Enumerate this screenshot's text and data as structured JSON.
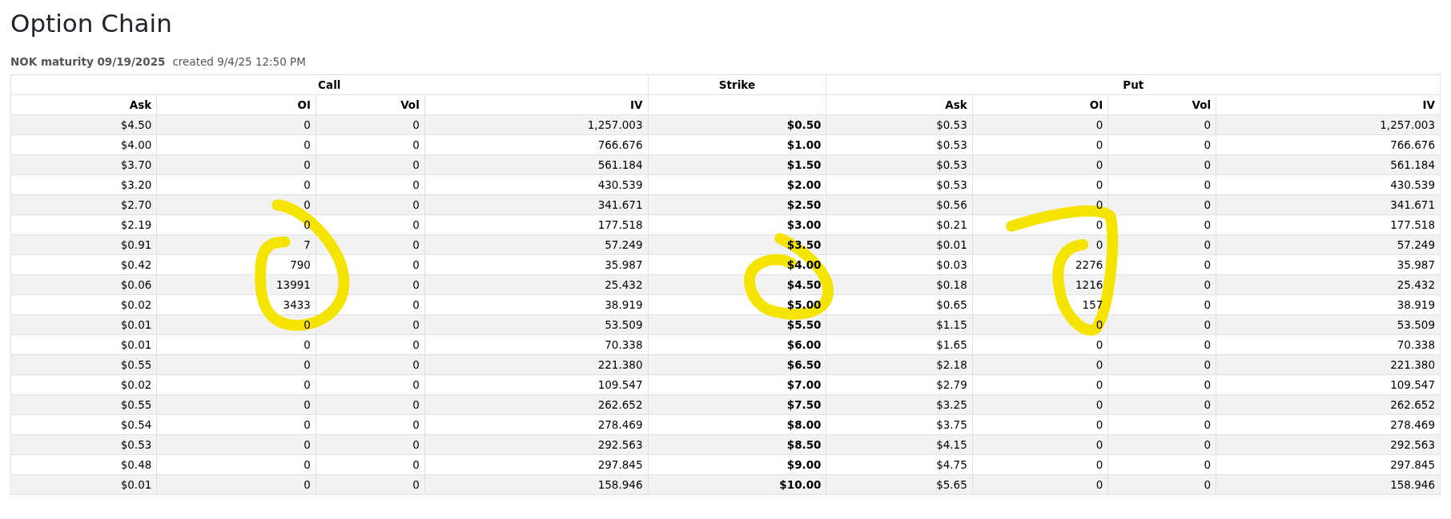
{
  "title": "Option Chain",
  "subtitle": {
    "symbol": "NOK maturity 09/19/2025",
    "created": "created 9/4/25 12:50 PM"
  },
  "table": {
    "groups": [
      "Call",
      "Strike",
      "Put"
    ],
    "columns": [
      "Ask",
      "OI",
      "Vol",
      "IV",
      "",
      "Ask",
      "OI",
      "Vol",
      "IV"
    ],
    "rows": [
      [
        "$4.50",
        "0",
        "0",
        "1,257.003",
        "$0.50",
        "$0.53",
        "0",
        "0",
        "1,257.003"
      ],
      [
        "$4.00",
        "0",
        "0",
        "766.676",
        "$1.00",
        "$0.53",
        "0",
        "0",
        "766.676"
      ],
      [
        "$3.70",
        "0",
        "0",
        "561.184",
        "$1.50",
        "$0.53",
        "0",
        "0",
        "561.184"
      ],
      [
        "$3.20",
        "0",
        "0",
        "430.539",
        "$2.00",
        "$0.53",
        "0",
        "0",
        "430.539"
      ],
      [
        "$2.70",
        "0",
        "0",
        "341.671",
        "$2.50",
        "$0.56",
        "0",
        "0",
        "341.671"
      ],
      [
        "$2.19",
        "0",
        "0",
        "177.518",
        "$3.00",
        "$0.21",
        "0",
        "0",
        "177.518"
      ],
      [
        "$0.91",
        "7",
        "0",
        "57.249",
        "$3.50",
        "$0.01",
        "0",
        "0",
        "57.249"
      ],
      [
        "$0.42",
        "790",
        "0",
        "35.987",
        "$4.00",
        "$0.03",
        "2276",
        "0",
        "35.987"
      ],
      [
        "$0.06",
        "13991",
        "0",
        "25.432",
        "$4.50",
        "$0.18",
        "1216",
        "0",
        "25.432"
      ],
      [
        "$0.02",
        "3433",
        "0",
        "38.919",
        "$5.00",
        "$0.65",
        "157",
        "0",
        "38.919"
      ],
      [
        "$0.01",
        "0",
        "0",
        "53.509",
        "$5.50",
        "$1.15",
        "0",
        "0",
        "53.509"
      ],
      [
        "$0.01",
        "0",
        "0",
        "70.338",
        "$6.00",
        "$1.65",
        "0",
        "0",
        "70.338"
      ],
      [
        "$0.55",
        "0",
        "0",
        "221.380",
        "$6.50",
        "$2.18",
        "0",
        "0",
        "221.380"
      ],
      [
        "$0.02",
        "0",
        "0",
        "109.547",
        "$7.00",
        "$2.79",
        "0",
        "0",
        "109.547"
      ],
      [
        "$0.55",
        "0",
        "0",
        "262.652",
        "$7.50",
        "$3.25",
        "0",
        "0",
        "262.652"
      ],
      [
        "$0.54",
        "0",
        "0",
        "278.469",
        "$8.00",
        "$3.75",
        "0",
        "0",
        "278.469"
      ],
      [
        "$0.53",
        "0",
        "0",
        "292.563",
        "$8.50",
        "$4.15",
        "0",
        "0",
        "292.563"
      ],
      [
        "$0.48",
        "0",
        "0",
        "297.845",
        "$9.00",
        "$4.75",
        "0",
        "0",
        "297.845"
      ],
      [
        "$0.01",
        "0",
        "0",
        "158.946",
        "$10.00",
        "$5.65",
        "0",
        "0",
        "158.946"
      ]
    ]
  }
}
